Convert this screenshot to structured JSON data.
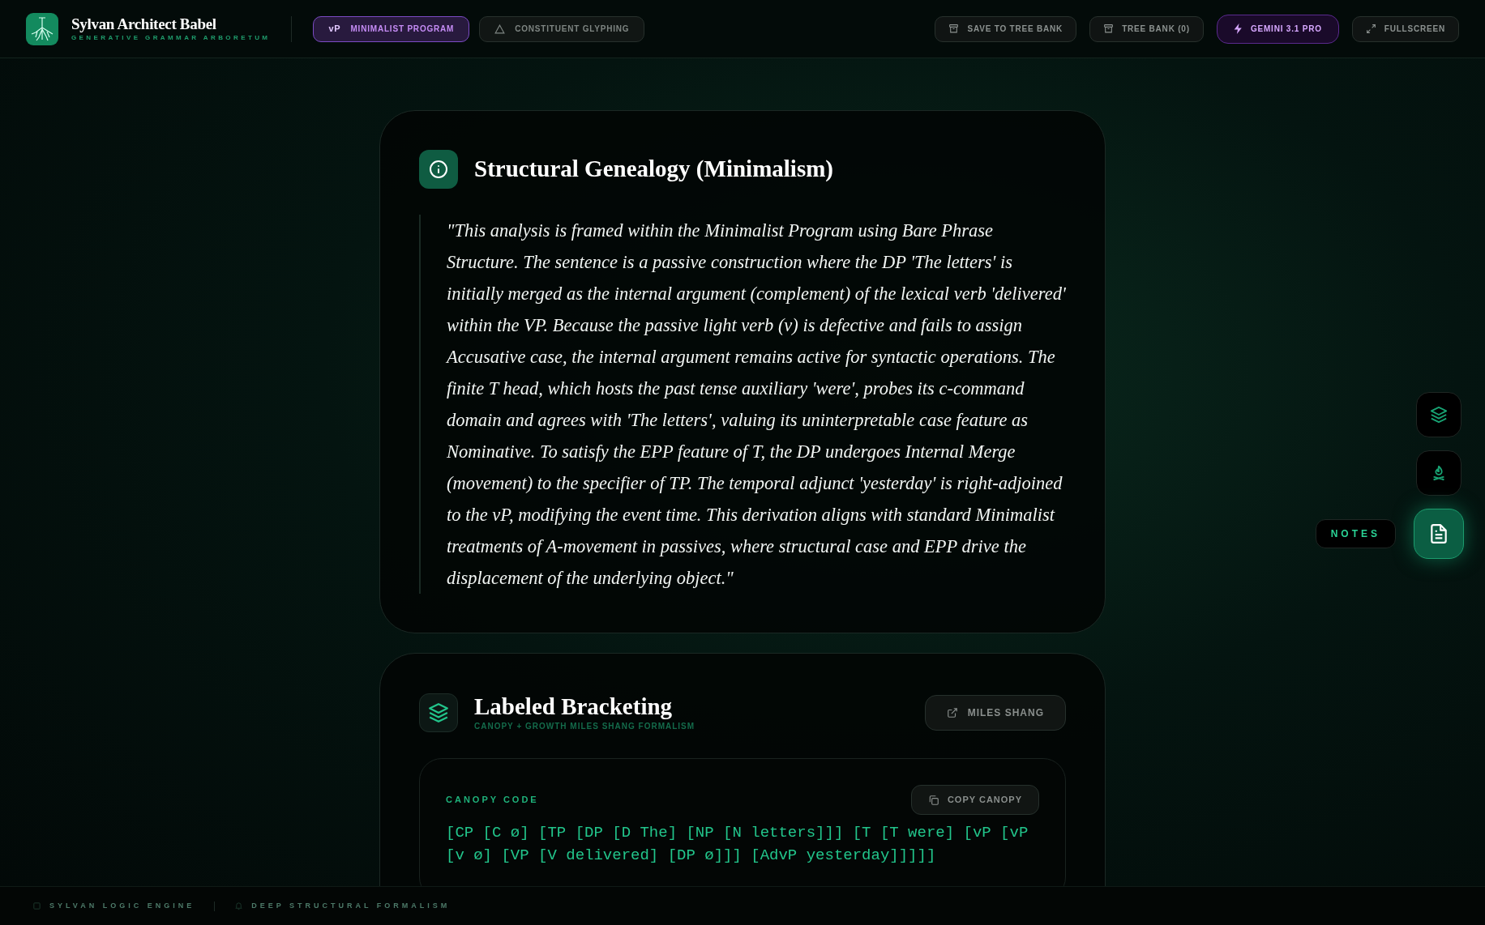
{
  "header": {
    "title": "Sylvan Architect Babel",
    "subtitle": "GENERATIVE GRAMMAR ARBORETUM",
    "modes": [
      {
        "badge": "vP",
        "label": "MINIMALIST PROGRAM",
        "selected": true
      },
      {
        "label": "CONSTITUENT GLYPHING",
        "selected": false
      }
    ],
    "actions": [
      {
        "kind": "box",
        "label": "SAVE TO TREE BANK"
      },
      {
        "kind": "box",
        "label": "TREE BANK (0)"
      },
      {
        "kind": "model",
        "label": "GEMINI 3.1 PRO"
      },
      {
        "kind": "expand",
        "label": "FULLSCREEN"
      }
    ]
  },
  "genealogy": {
    "title": "Structural Genealogy (Minimalism)",
    "text": "\"This analysis is framed within the Minimalist Program using Bare Phrase Structure. The sentence is a passive construction where the DP 'The letters' is initially merged as the internal argument (complement) of the lexical verb 'delivered' within the VP. Because the passive light verb (v) is defective and fails to assign Accusative case, the internal argument remains active for syntactic operations. The finite T head, which hosts the past tense auxiliary 'were', probes its c-command domain and agrees with 'The letters', valuing its uninterpretable case feature as Nominative. To satisfy the EPP feature of T, the DP undergoes Internal Merge (movement) to the specifier of TP. The temporal adjunct 'yesterday' is right-adjoined to the vP, modifying the event time. This derivation aligns with standard Minimalist treatments of A-movement in passives, where structural case and EPP drive the displacement of the underlying object.\""
  },
  "bracketing": {
    "title": "Labeled Bracketing",
    "subtitle": "CANOPY + GROWTH MILES SHANG FORMALISM",
    "link": "MILES SHANG",
    "code_label": "CANOPY CODE",
    "copy": "COPY CANOPY",
    "code": "[CP [C ø] [TP [DP [D The] [NP [N letters]]] [T [T were] [vP [vP [v ø] [VP [V delivered] [DP ø]]] [AdvP yesterday]]]]]"
  },
  "side_tools": [
    {
      "kind": "layers",
      "selected": false
    },
    {
      "kind": "fire",
      "selected": false
    },
    {
      "kind": "notes",
      "selected": true,
      "tooltip": "NOTES"
    }
  ],
  "footer": [
    "SYLVAN LOGIC ENGINE",
    "DEEP STRUCTURAL FORMALISM"
  ]
}
